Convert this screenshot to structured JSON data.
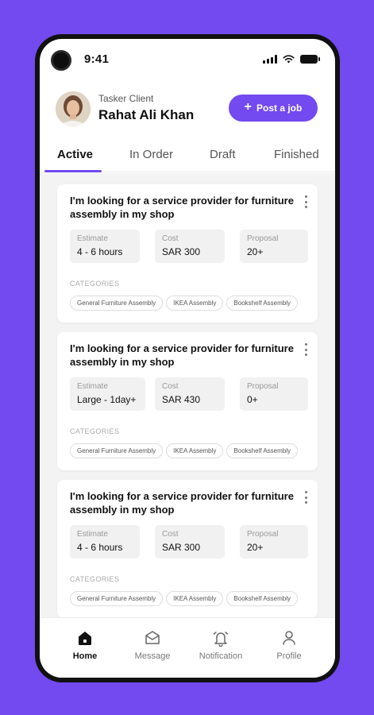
{
  "status_bar": {
    "time": "9:41"
  },
  "header": {
    "greeting": "Tasker Client",
    "user_name": "Rahat Ali Khan",
    "post_button_label": "Post a job",
    "avatar": "user-avatar-photo"
  },
  "tabs": [
    {
      "label": "Active",
      "active": true
    },
    {
      "label": "In Order",
      "active": false
    },
    {
      "label": "Draft",
      "active": false
    },
    {
      "label": "Finished",
      "active": false
    }
  ],
  "jobs": [
    {
      "title": "I'm looking for a service provider for furniture assembly in my shop",
      "estimate_label": "Estimate",
      "estimate": "4 - 6 hours",
      "cost_label": "Cost",
      "cost": "SAR 300",
      "proposal_label": "Proposal",
      "proposal": "20+",
      "categories_label": "CATEGORIES",
      "categories": [
        "General Furniture Assembly",
        "IKEA Assembly",
        "Bookshelf Assembly"
      ]
    },
    {
      "title": "I'm looking for a service provider for furniture assembly in my shop",
      "estimate_label": "Estimate",
      "estimate": "Large - 1day+",
      "cost_label": "Cost",
      "cost": "SAR 430",
      "proposal_label": "Proposal",
      "proposal": "0+",
      "categories_label": "CATEGORIES",
      "categories": [
        "General Furniture Assembly",
        "IKEA Assembly",
        "Bookshelf Assembly"
      ]
    },
    {
      "title": "I'm looking for a service provider for furniture assembly in my shop",
      "estimate_label": "Estimate",
      "estimate": "4 - 6 hours",
      "cost_label": "Cost",
      "cost": "SAR 300",
      "proposal_label": "Proposal",
      "proposal": "20+",
      "categories_label": "CATEGORIES",
      "categories": [
        "General Furniture Assembly",
        "IKEA Assembly",
        "Bookshelf Assembly"
      ]
    }
  ],
  "bottom_nav": [
    {
      "label": "Home",
      "icon": "home-icon",
      "active": true
    },
    {
      "label": "Message",
      "icon": "mail-icon",
      "active": false
    },
    {
      "label": "Notification",
      "icon": "bell-icon",
      "active": false
    },
    {
      "label": "Profile",
      "icon": "person-icon",
      "active": false
    }
  ],
  "colors": {
    "accent": "#7349f0",
    "background": "#7349f0",
    "feed_bg": "#f3f3f3"
  }
}
